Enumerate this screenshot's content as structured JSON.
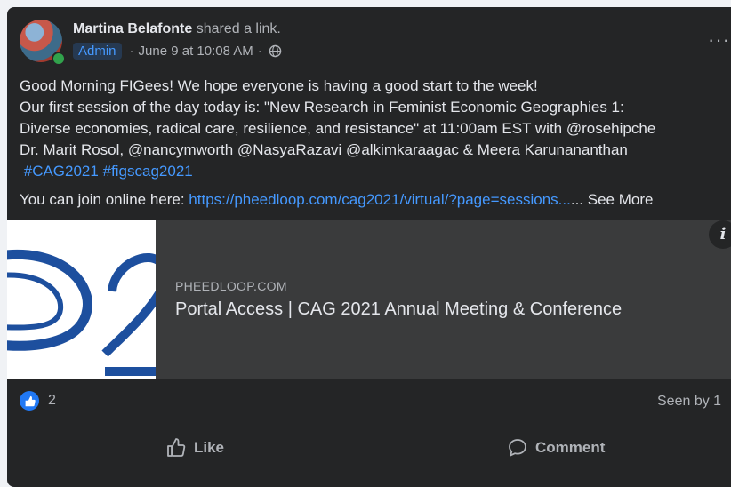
{
  "post": {
    "author": "Martina Belafonte",
    "action_text": " shared a link.",
    "badge": "Admin",
    "timestamp": "June 9 at 10:08 AM",
    "separator": "·",
    "audience_icon": "globe-icon",
    "more_icon": "···",
    "body": {
      "line1": "Good Morning FIGees! We hope everyone is having a good start to the week!",
      "line2": "Our first session of the day today is: \"New Research in Feminist Economic Geographies 1:",
      "line3": "Diverse economies, radical care, resilience, and resistance\" at 11:00am EST with @rosehipche",
      "line4": "Dr. Marit Rosol, @nancymworth @NasyaRazavi @alkimkaraagac & Meera Karunananthan",
      "hashtag1": "#CAG2021",
      "hashtag2": "#figscag2021",
      "join_text": "You can join online here: ",
      "link": "https://pheedloop.com/cag2021/virtual/?page=sessions...",
      "ellipsis": "...",
      "see_more": " See More"
    },
    "preview": {
      "domain": "PHEEDLOOP.COM",
      "title": "Portal Access | CAG 2021 Annual Meeting & Conference",
      "info_icon": "i"
    },
    "reactions": {
      "count": "2",
      "seen_by": "Seen by 1"
    },
    "actions": {
      "like": "Like",
      "comment": "Comment"
    }
  },
  "colors": {
    "card": "#242526",
    "text": "#e4e6eb",
    "muted": "#b0b3b8",
    "link": "#4599ff",
    "like": "#2078f4"
  }
}
